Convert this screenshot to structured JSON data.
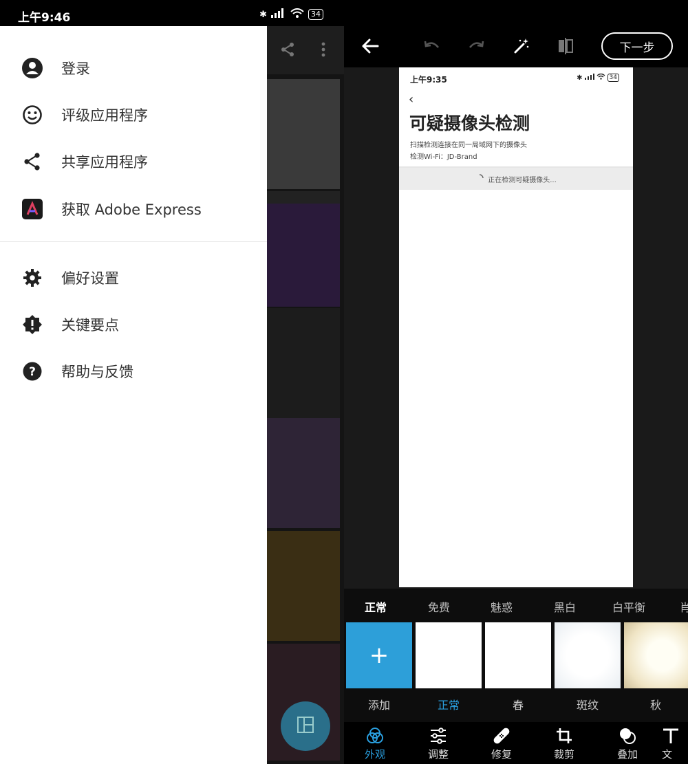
{
  "left_status": {
    "time": "上午9:46",
    "battery": "34"
  },
  "drawer": {
    "items": [
      {
        "label": "登录",
        "icon": "account-circle-icon"
      },
      {
        "label": "评级应用程序",
        "icon": "smile-icon"
      },
      {
        "label": "共享应用程序",
        "icon": "share-icon"
      },
      {
        "label": "获取 Adobe Express",
        "icon": "adobe-express-icon"
      },
      {
        "label": "偏好设置",
        "icon": "gear-icon"
      },
      {
        "label": "关键要点",
        "icon": "alert-badge-icon"
      },
      {
        "label": "帮助与反馈",
        "icon": "help-icon"
      }
    ]
  },
  "editor": {
    "next_label": "下一步",
    "inner": {
      "status_time": "上午9:35",
      "battery": "34",
      "title": "可疑摄像头检测",
      "subtitle": "扫描检测连接在同一局域网下的摄像头",
      "wifi_label": "检测Wi-Fi：JD-Brand",
      "scanning_text": "正在检测可疑摄像头..."
    },
    "filter_tabs": [
      "正常",
      "免费",
      "魅惑",
      "黑白",
      "白平衡",
      "肖"
    ],
    "thumbnails": [
      {
        "label": "添加",
        "kind": "add"
      },
      {
        "label": "正常",
        "kind": "white"
      },
      {
        "label": "春",
        "kind": "white"
      },
      {
        "label": "斑纹",
        "kind": "light"
      },
      {
        "label": "秋",
        "kind": "warm"
      }
    ],
    "bottom_nav": [
      "外观",
      "调整",
      "修复",
      "裁剪",
      "叠加",
      "文"
    ]
  },
  "colors": {
    "accent": "#2aa0e0",
    "add_tile": "#2d9fd9"
  }
}
